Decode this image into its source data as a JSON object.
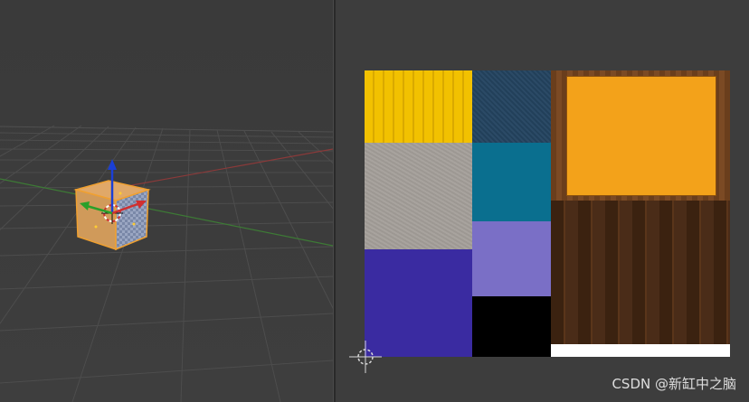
{
  "viewport": {
    "axis_x_color": "#c44a4a",
    "axis_y_color": "#4f9a3f",
    "axis_z_color": "#1a3fd6",
    "selection_color": "#f0a030",
    "object_icon": "cube-icon",
    "cursor_icon": "3d-cursor-icon"
  },
  "uv_editor": {
    "texture_swatches": [
      {
        "name": "yellow-plank",
        "color": "#f2c100"
      },
      {
        "name": "blue-denim",
        "color": "#2b4a66"
      },
      {
        "name": "orange-board",
        "color": "#f3a21a"
      },
      {
        "name": "grey-concrete",
        "color": "#a5a09b"
      },
      {
        "name": "teal",
        "color": "#0a6f8f"
      },
      {
        "name": "lavender",
        "color": "#7a6fc6"
      },
      {
        "name": "indigo",
        "color": "#3a2ba1"
      },
      {
        "name": "black",
        "color": "#000000"
      },
      {
        "name": "dark-wood",
        "color": "#4a2c18"
      },
      {
        "name": "white-strip",
        "color": "#ffffff"
      }
    ],
    "cursor_icon": "2d-cursor-icon"
  },
  "watermark": {
    "text": "CSDN @新缸中之脑"
  }
}
